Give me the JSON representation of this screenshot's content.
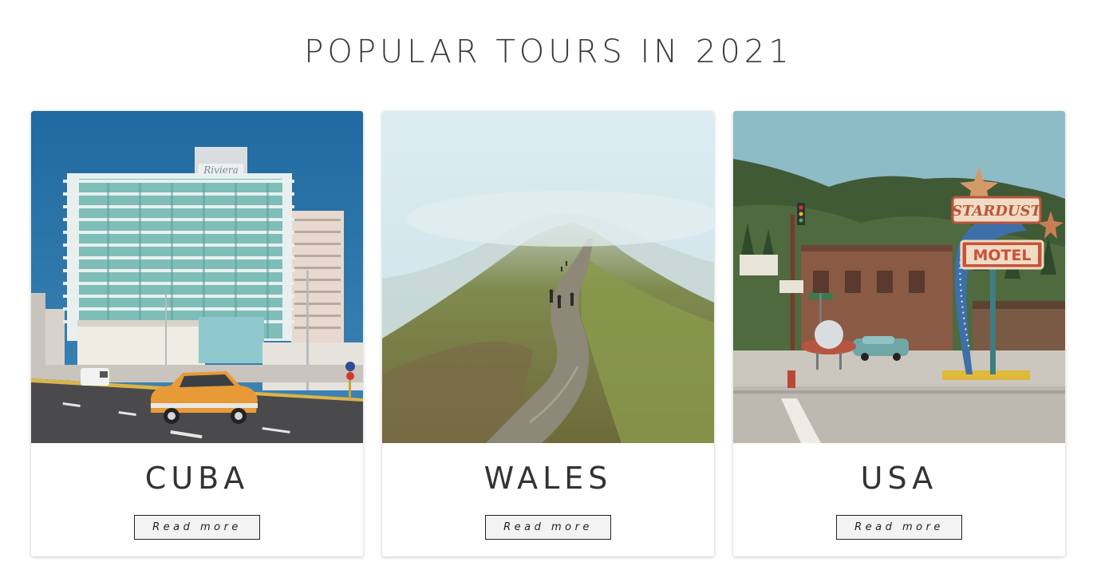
{
  "section": {
    "title": "POPULAR TOURS IN 2021"
  },
  "tours": [
    {
      "name": "CUBA",
      "button_label": "Read more",
      "image": "havana-hotel-vintage-car-photo",
      "sign_text": "Riviera"
    },
    {
      "name": "WALES",
      "button_label": "Read more",
      "image": "misty-mountain-trail-hikers-photo"
    },
    {
      "name": "USA",
      "button_label": "Read more",
      "image": "stardust-motel-roadside-photo",
      "sign_line1": "STARDUST",
      "sign_line2": "MOTEL"
    }
  ]
}
